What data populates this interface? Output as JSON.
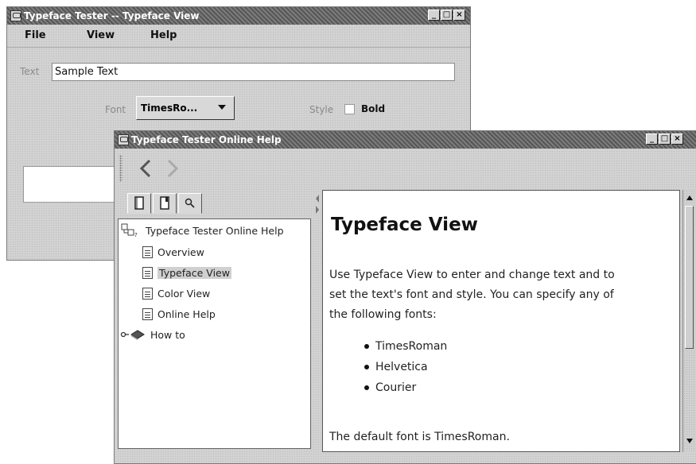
{
  "tester_window": {
    "title": "Typeface Tester -- Typeface View",
    "menu": [
      "File",
      "View",
      "Help"
    ],
    "text_label": "Text",
    "text_value": "Sample Text",
    "font_label": "Font",
    "font_value": "TimesRo...",
    "style_label": "Style",
    "bold_label": "Bold"
  },
  "help_window": {
    "title": "Typeface Tester Online Help",
    "tree": {
      "root": "Typeface Tester Online Help",
      "items": [
        "Overview",
        "Typeface View",
        "Color View",
        "Online Help"
      ],
      "folder": "How to"
    },
    "content": {
      "heading": "Typeface View",
      "paragraph_lines": [
        "Use Typeface View to enter and change text and to",
        "set the text's font and style. You can specify any of",
        "the following fonts:"
      ],
      "bullets": [
        "TimesRoman",
        "Helvetica",
        "Courier"
      ],
      "footer": "The default font is TimesRoman."
    }
  },
  "icons": {
    "back": "back-arrow-icon",
    "forward": "forward-arrow-icon",
    "toc": "toc-tab-icon",
    "index": "index-tab-icon",
    "search": "search-icon"
  },
  "colors": {
    "titlebar": "#575757",
    "window_bg": "#d2d2d2",
    "selected_item_bg": "#d0d0d0"
  }
}
